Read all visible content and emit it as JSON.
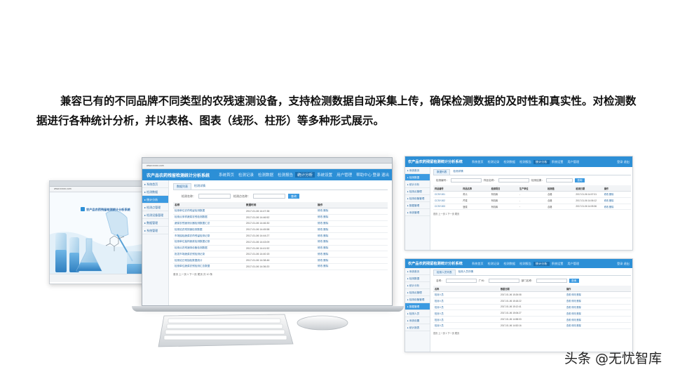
{
  "caption": "兼容已有的不同品牌不同类型的农残速测设备，支持检测数据自动采集上传，确保检测数据的及时性和真实性。对检测数据进行各种统计分析，并以表格、图表（线形、柱形）等多种形式展示。",
  "login": {
    "url": "www.xxxxx.com",
    "system_title": "农产品农药残留检测统计分析系统"
  },
  "laptop": {
    "url": "www.xxxxx.com",
    "system_title": "农产品农药残留检测统计分析系统",
    "nav": [
      "系统首页",
      "检测记录",
      "检测数据",
      "检测报告",
      "统计分析",
      "系统设置",
      "用户管理",
      "帮助中心"
    ],
    "nav_active": 4,
    "user": "登录  退出",
    "sidebar": [
      "系统首页",
      "检测数据",
      "统计分析",
      "检测点管理",
      "检测设备管理",
      "数据管理",
      "系统管理"
    ],
    "sidebar_active": 2,
    "tabs": [
      "数据列表",
      "检测详情"
    ],
    "filter_labels": [
      "检测名称：",
      "检测点名称："
    ],
    "search_btn": "查询",
    "columns": [
      "名称",
      "数据时间",
      "操作"
    ],
    "rows": [
      [
        "检测单位农药残留检测数据",
        "2017-01-06 14:47:38",
        "修改 删除"
      ],
      [
        "检测点采样蔬菜农残检测数据",
        "2017-01-06 14:46:52",
        "修改 删除"
      ],
      [
        "蔬菜农残速测仪器检测数据汇总",
        "2017-01-06 14:46:30",
        "修改 删除"
      ],
      [
        "检测站农残快速检测数据",
        "2017-01-06 14:45:58",
        "修改 删除"
      ],
      [
        "市场抽检蔬菜农药残留检测记录",
        "2017-01-06 14:44:27",
        "修改 删除"
      ],
      [
        "检测单位抽样蔬菜检测数据记录",
        "2017-01-06 14:43:09",
        "修改 删除"
      ],
      [
        "检测点农残速测设备检测数据",
        "2017-01-06 14:41:52",
        "修改 删除"
      ],
      [
        "批发市场蔬菜农残检测记录",
        "2017-01-06 14:40:15",
        "修改 删除"
      ],
      [
        "检测站日常抽检数据统计",
        "2017-01-06 14:38:46",
        "修改 删除"
      ],
      [
        "检测单位蔬菜农残检测汇总数据",
        "2017-01-06 14:36:20",
        "修改 删除"
      ]
    ],
    "pager": "首页  上一页  1  下一页  尾页    共 10 条"
  },
  "win_top": {
    "system_title": "农产品农药残留检测统计分析系统",
    "nav": [
      "系统首页",
      "检测记录",
      "检测数据",
      "检测报告",
      "统计分析",
      "系统设置",
      "用户管理"
    ],
    "nav_active": 4,
    "user": "登录  退出",
    "sidebar": [
      "系统首页",
      "检测数据",
      "统计分析",
      "检测点管理",
      "检测设备管理",
      "数据管理",
      "系统管理"
    ],
    "sidebar_active": 1,
    "tabs": [
      "数据列表",
      "检测详情"
    ],
    "filter_labels": [
      "检测编号：",
      "样品名称：",
      "检测结果："
    ],
    "search_btn": "查询",
    "columns": [
      "样品编号",
      "样品名称",
      "检测项目",
      "生产单位",
      "检测值",
      "检测日期",
      "操作"
    ],
    "rows": [
      [
        "CCSY-001",
        "黄瓜",
        "有机磷",
        "-",
        "合格",
        "2017-01-06 14:07:01",
        "修改 删除"
      ],
      [
        "CCSY-002",
        "芹菜",
        "有机磷",
        "-",
        "合格",
        "2017-01-06 14:06:12",
        "修改 删除"
      ],
      [
        "CCSY-003",
        "菠菜",
        "有机磷",
        "-",
        "合格",
        "2017-01-06 14:05:36",
        "修改 删除"
      ]
    ],
    "pager": "首页  上一页  1  下一页  尾页"
  },
  "win_bottom": {
    "system_title": "农产品农药残留检测统计分析系统",
    "nav": [
      "系统首页",
      "检测记录",
      "检测数据",
      "检测报告",
      "统计分析",
      "系统设置",
      "用户管理"
    ],
    "nav_active": 4,
    "user": "登录  退出",
    "sidebar": [
      "系统首页",
      "检测数据",
      "统计分析",
      "检测点管理",
      "检测设备管理",
      "数据管理",
      "检测人员",
      "系统设置",
      "统计报表"
    ],
    "sidebar_active": 5,
    "tabs": [
      "检测人员列表",
      "检测人员详情"
    ],
    "filter_labels": [
      "名称：",
      "广州：",
      "部门名称："
    ],
    "search_btn": "查询",
    "columns": [
      "名称",
      "数据日期",
      "操作"
    ],
    "rows": [
      [
        "检测人员",
        "2017-01-06 15:26:08",
        "查看 修改 删除"
      ],
      [
        "检测人员",
        "2017-01-06 15:18:22",
        "查看 修改 删除"
      ],
      [
        "检测人员",
        "2017-01-06 15:12:41",
        "查看 修改 删除"
      ],
      [
        "检测人员",
        "2017-01-06 15:06:27",
        "查看 修改 删除"
      ],
      [
        "检测人员",
        "2017-01-06 14:58:03",
        "查看 修改 删除"
      ],
      [
        "检测人员",
        "2017-01-06 14:52:16",
        "查看 修改 删除"
      ]
    ],
    "pager": "首页  上一页  1  下一页  尾页"
  },
  "watermark": "头条 @无忧智库",
  "colors": {
    "accent": "#2c8fd6",
    "sidebar_active": "#3b9ae1",
    "link": "#2c6ca5"
  }
}
